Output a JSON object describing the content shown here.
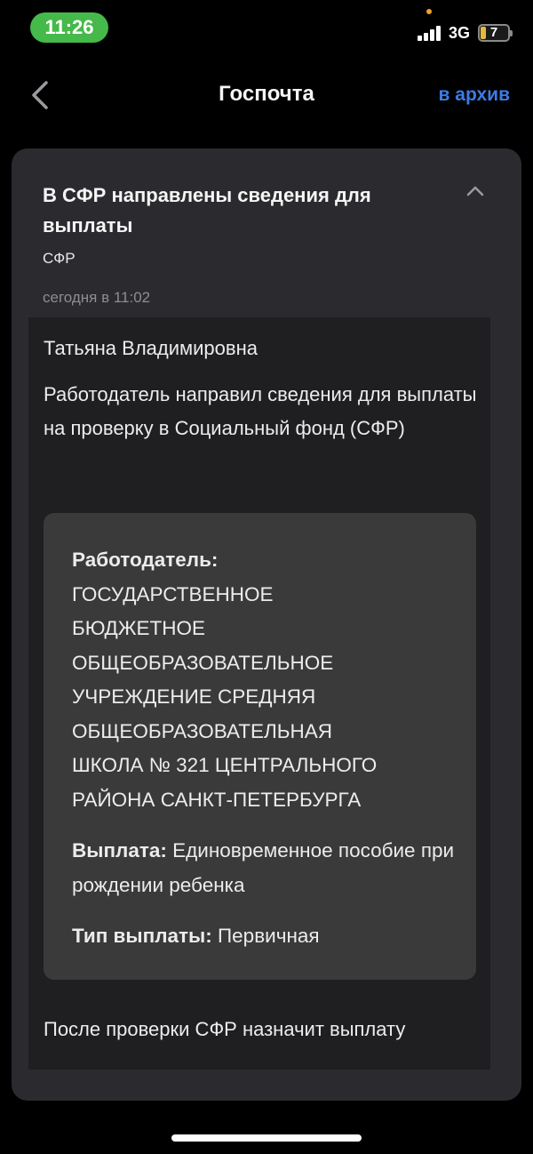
{
  "status_bar": {
    "time": "11:26",
    "network": "3G",
    "battery_level": "7",
    "time_pill_color": "#45b94a"
  },
  "nav": {
    "title": "Госпочта",
    "archive_label": "в архив",
    "back_icon": "chevron-left-icon",
    "accent_color": "#3d7ce4"
  },
  "message": {
    "title": "В СФР направлены сведения для выплаты",
    "sender": "СФР",
    "date": "сегодня в 11:02",
    "collapse_icon": "chevron-up-icon",
    "greeting": "Татьяна Владимировна",
    "lead": "Работодатель направил сведения для выплаты на проверку в Социальный фонд (СФР)",
    "details": {
      "employer_label": "Работодатель:",
      "employer_name": "ГОСУДАРСТВЕННОЕ\nБЮДЖЕТНОЕ\nОБЩЕОБРАЗОВАТЕЛЬНОЕ\nУЧРЕЖДЕНИЕ СРЕДНЯЯ\nОБЩЕОБРАЗОВАТЕЛЬНАЯ\nШКОЛА № 321 ЦЕНТРАЛЬНОГО\nРАЙОНА САНКТ-ПЕТЕРБУРГА",
      "payment_label": "Выплата:",
      "payment_value": "Единовременное пособие при рождении ребенка",
      "payment_type_label": "Тип выплаты:",
      "payment_type_value": "Первичная"
    },
    "footer": "После проверки СФР назначит выплату"
  }
}
